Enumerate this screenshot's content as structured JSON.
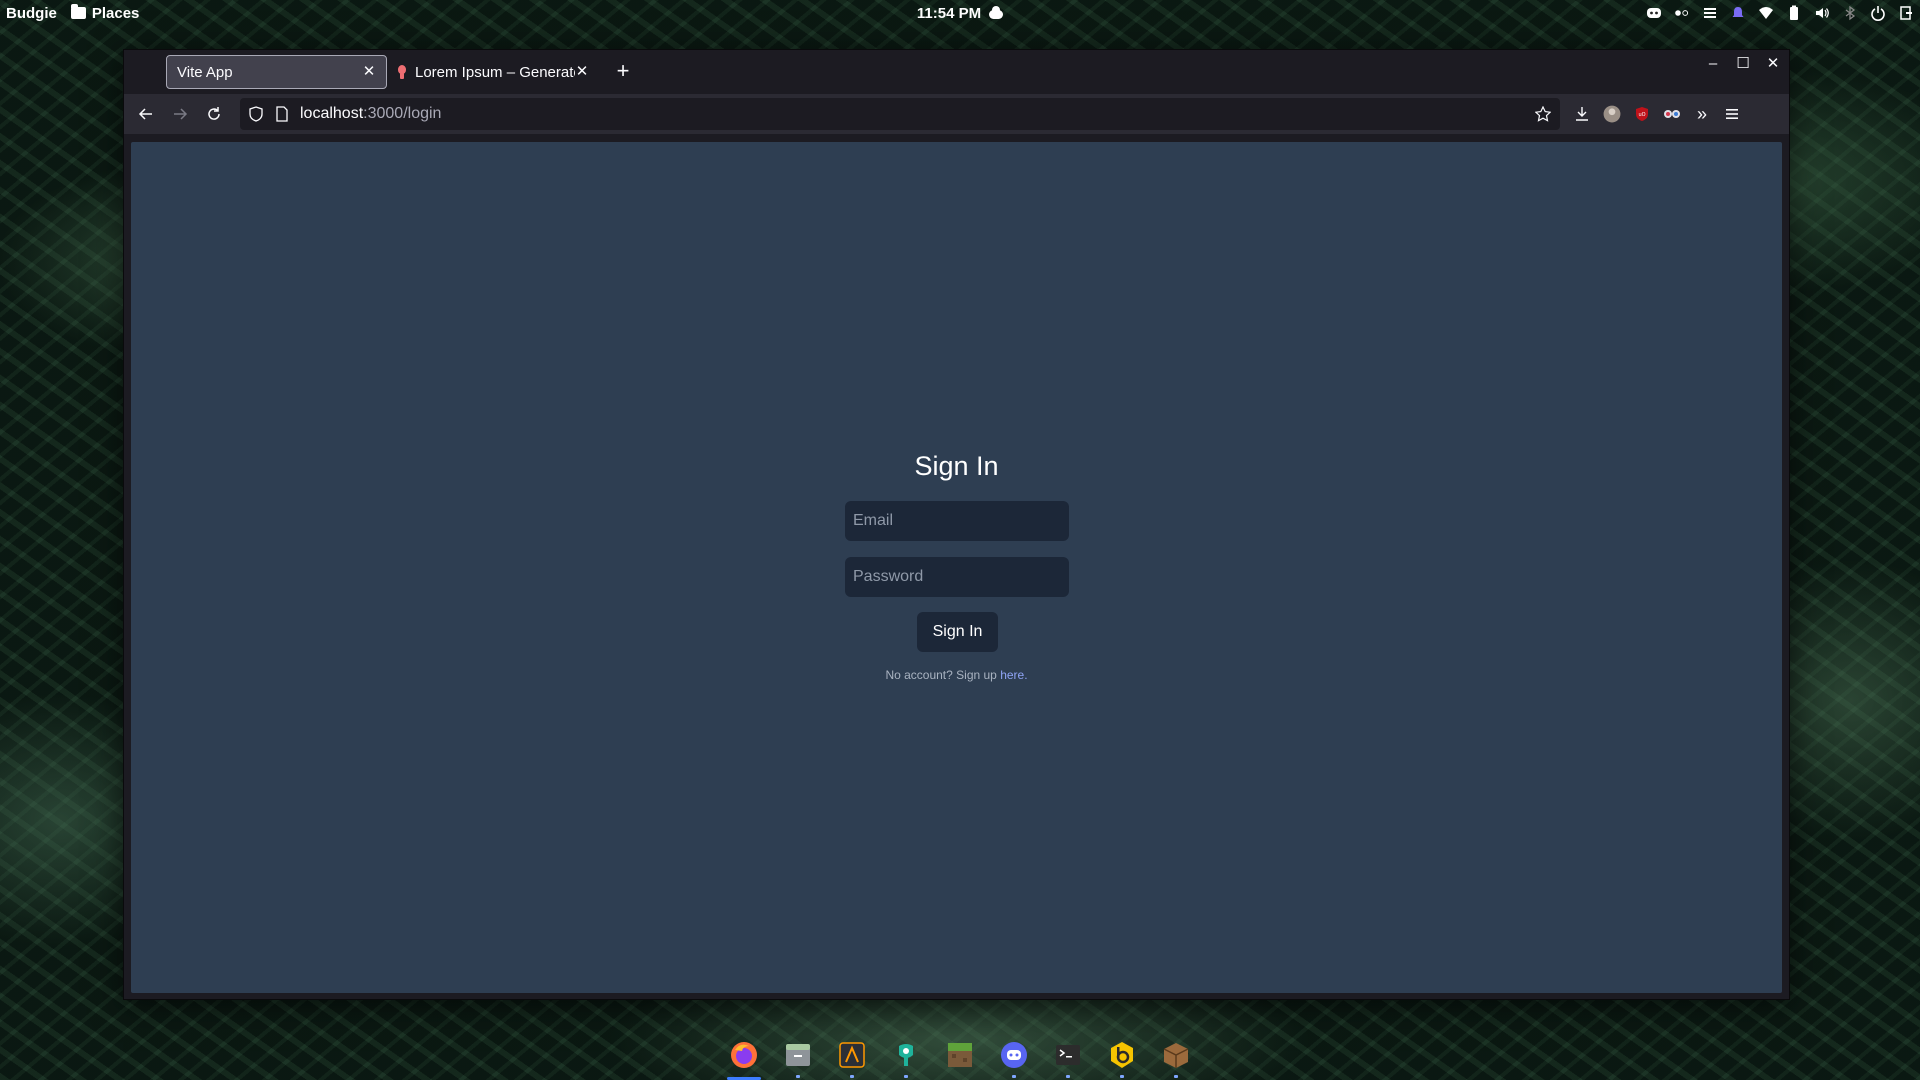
{
  "panel": {
    "menu_label": "Budgie",
    "places_label": "Places",
    "clock": "11:54 PM"
  },
  "browser": {
    "tabs": [
      {
        "title": "Vite App",
        "active": true
      },
      {
        "title": "Lorem Ipsum – Generator",
        "active": false
      }
    ],
    "url_host": "localhost",
    "url_path": ":3000/login"
  },
  "login": {
    "title": "Sign In",
    "email_placeholder": "Email",
    "password_placeholder": "Password",
    "button_label": "Sign In",
    "signup_prompt": "No account? Sign up ",
    "signup_link": "here."
  },
  "dock": {
    "apps": [
      "firefox-icon",
      "files-icon",
      "sublime-icon",
      "app-icon",
      "minecraft-icon",
      "discord-icon",
      "terminal-icon",
      "brave-icon",
      "package-icon"
    ]
  },
  "colors": {
    "page_bg": "#2e3e52",
    "input_bg": "#1c2738",
    "link": "#8fa4f5",
    "browser_chrome": "#1c1b22"
  }
}
